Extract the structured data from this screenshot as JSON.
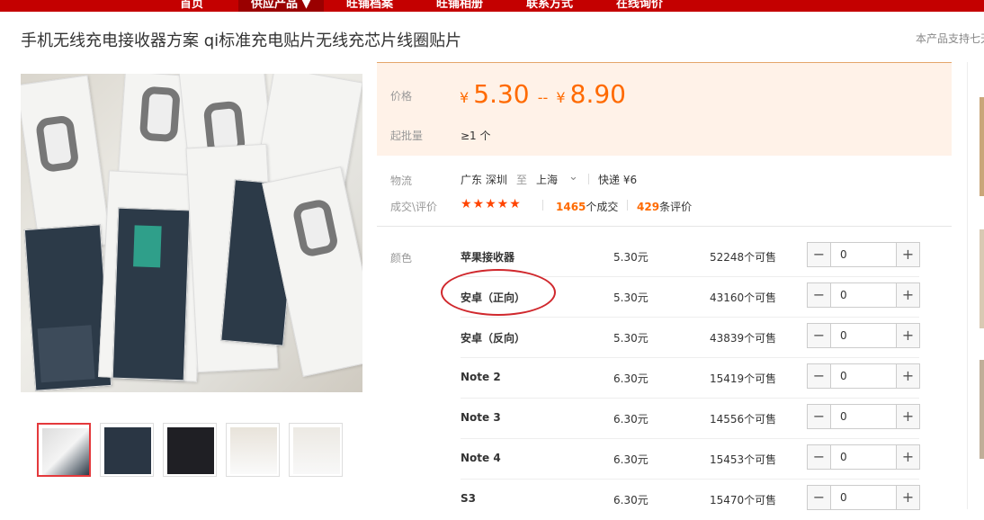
{
  "nav": {
    "items": [
      "首页",
      "供应产品 ▼",
      "旺铺档案",
      "旺铺相册",
      "联系方式",
      "在线询价"
    ]
  },
  "product": {
    "title": "手机无线充电接收器方案 qi标准充电贴片无线充芯片线圈贴片",
    "support_note": "本产品支持七天"
  },
  "price": {
    "label": "价格",
    "currency": "¥",
    "low": "5.30",
    "separator": "--",
    "high": "8.90",
    "moq_label": "起批量",
    "moq_value": "≥1 个"
  },
  "logistics": {
    "label": "物流",
    "from": "广东 深圳",
    "to_word": "至",
    "to": "上海",
    "shipping": "快递 ¥6"
  },
  "deals": {
    "label": "成交\\评价",
    "stars": "★★★★★",
    "count": "1465",
    "count_suffix": "个成交",
    "reviews": "429",
    "reviews_suffix": "条评价"
  },
  "color_label": "颜色",
  "skus": [
    {
      "name": "苹果接收器",
      "price": "5.30元",
      "stock": "52248个可售",
      "qty": "0"
    },
    {
      "name": "安卓（正向）",
      "price": "5.30元",
      "stock": "43160个可售",
      "qty": "0"
    },
    {
      "name": "安卓（反向）",
      "price": "5.30元",
      "stock": "43839个可售",
      "qty": "0"
    },
    {
      "name": "Note 2",
      "price": "6.30元",
      "stock": "15419个可售",
      "qty": "0"
    },
    {
      "name": "Note 3",
      "price": "6.30元",
      "stock": "14556个可售",
      "qty": "0"
    },
    {
      "name": "Note 4",
      "price": "6.30元",
      "stock": "15453个可售",
      "qty": "0"
    },
    {
      "name": "S3",
      "price": "6.30元",
      "stock": "15470个可售",
      "qty": "0"
    }
  ],
  "stepper": {
    "minus": "−",
    "plus": "+"
  },
  "colors": {
    "brand_red": "#c40000",
    "price_orange": "#ff6a00",
    "annotation_red": "#d0282d"
  }
}
